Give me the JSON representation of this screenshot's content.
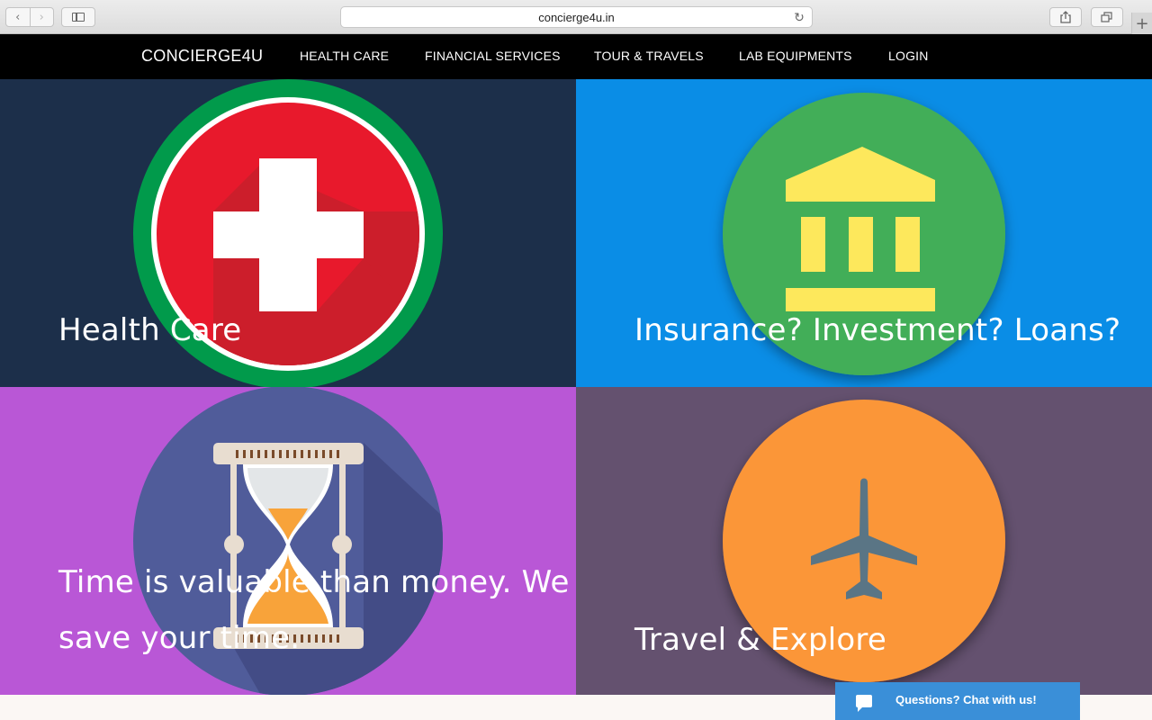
{
  "browser": {
    "url": "concierge4u.in",
    "back_glyph": "‹",
    "forward_glyph": "›",
    "reload_glyph": "↻",
    "new_tab_glyph": "+"
  },
  "navbar": {
    "brand": "CONCIERGE4U",
    "links": [
      "HEALTH CARE",
      "FINANCIAL SERVICES",
      "TOUR & TRAVELS",
      "LAB EQUIPMENTS",
      "LOGIN"
    ]
  },
  "tiles": {
    "health": {
      "caption": "Health Care",
      "bg": "#1c2f4a",
      "icon": "medical-cross-icon"
    },
    "finance": {
      "caption": "Insurance? Investment? Loans?",
      "bg": "#0a8de6",
      "icon": "bank-icon"
    },
    "time": {
      "caption_line1": "Time is valuable than money. We",
      "caption_line2": "save your time.",
      "bg": "#b957d6",
      "icon": "hourglass-icon"
    },
    "travel": {
      "caption": "Travel & Explore",
      "bg": "#64516f",
      "icon": "airplane-icon"
    }
  },
  "chat": {
    "label": "Questions? Chat with us!",
    "icon": "chat-bubble-icon"
  }
}
